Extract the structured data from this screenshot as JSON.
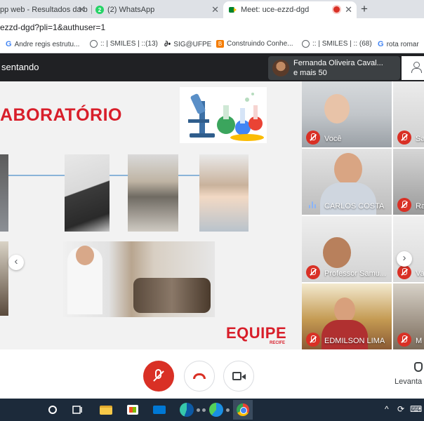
{
  "browser": {
    "tabs": [
      {
        "title": "pp web - Resultados da b",
        "close": "✕",
        "active": false
      },
      {
        "title": "(2) WhatsApp",
        "badge": "2",
        "close": "✕",
        "active": false
      },
      {
        "title": "Meet: uce-ezzd-dgd",
        "close": "✕",
        "active": true
      }
    ],
    "new_tab": "+",
    "url": "ezzd-dgd?pli=1&authuser=1",
    "bookmarks": [
      {
        "label": "Andre regis estrutu...",
        "icon": "google-icon"
      },
      {
        "label": ":: | SMILES | ::(13)",
        "icon": "globe-icon"
      },
      {
        "label": "SIG@UFPE",
        "icon": "sig-icon",
        "icon_text": "∂•"
      },
      {
        "label": "Construindo Conhe...",
        "icon": "blogger-icon",
        "icon_text": "B"
      },
      {
        "label": ":: | SMILES | :: (68)",
        "icon": "globe-icon"
      },
      {
        "label": "rota romar",
        "icon": "google-icon"
      }
    ]
  },
  "meet": {
    "presenting_text": "sentando",
    "presenter": {
      "name": "Fernanda Oliveira Caval...",
      "more": "e mais 50"
    },
    "slide": {
      "title": "ABORATÓRIO",
      "logo": "EQUIPE",
      "logo_sub": "RECIFE"
    },
    "slide_nav": {
      "prev": "‹"
    },
    "participants": [
      {
        "name": "Você",
        "muted": true
      },
      {
        "name": "Sa",
        "muted": true
      },
      {
        "name": "CARLOS COSTA",
        "muted": false,
        "speaking": true
      },
      {
        "name": "Ra",
        "muted": true
      },
      {
        "name": "Professor Samu...",
        "muted": true
      },
      {
        "name": "Va",
        "muted": true
      },
      {
        "name": "EDMILSON LIMA",
        "muted": true
      },
      {
        "name": "M",
        "muted": true
      }
    ],
    "tiles_nav": {
      "next": "›"
    },
    "controls": {
      "raise_hand": "Levanta"
    }
  },
  "taskbar": {
    "tray_up": "^",
    "tray_icons": [
      "⟳",
      "⌨"
    ]
  },
  "colors": {
    "slide_red": "#d81e2a",
    "mute_red": "#d93025",
    "meet_dark": "#202124"
  }
}
